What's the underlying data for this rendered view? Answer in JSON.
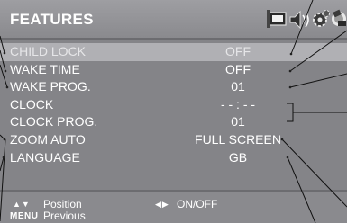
{
  "menu": {
    "title": "FEATURES",
    "icons": [
      "picture-icon",
      "sound-icon",
      "features-icon",
      "install-icon"
    ],
    "items": [
      {
        "label": "CHILD LOCK",
        "value": "OFF"
      },
      {
        "label": "WAKE TIME",
        "value": "OFF"
      },
      {
        "label": "WAKE PROG.",
        "value": "01"
      },
      {
        "label": "CLOCK",
        "value": "- - : - -"
      },
      {
        "label": "CLOCK PROG.",
        "value": "01"
      },
      {
        "label": "ZOOM AUTO",
        "value": "FULL SCREEN"
      },
      {
        "label": "LANGUAGE",
        "value": "GB"
      }
    ],
    "highlighted_index": 0
  },
  "footer": {
    "nav_glyph": "▲▼",
    "nav_label": "Position",
    "toggle_glyph": "◀▶",
    "toggle_label": "ON/OFF",
    "menu_key": "MENU",
    "menu_label": "Previous"
  },
  "colors": {
    "background": "#848488",
    "highlight": "#b0b0b4",
    "text": "#ffffff"
  }
}
